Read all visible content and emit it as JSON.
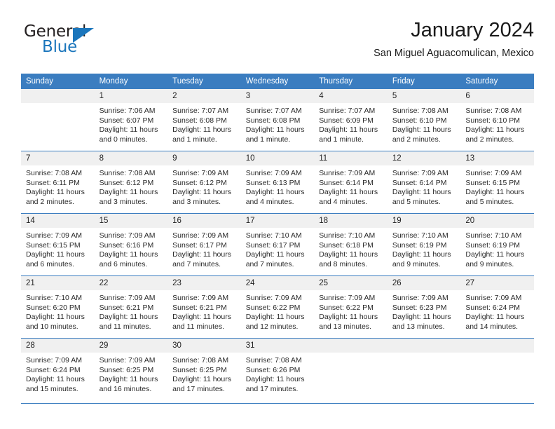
{
  "brand": {
    "word_one": "General",
    "word_two": "Blue",
    "logo_icon": "triangle-logo-icon",
    "accent_color": "#1b76bc"
  },
  "header": {
    "title": "January 2024",
    "subtitle": "San Miguel Aguacomulican, Mexico"
  },
  "theme": {
    "header_blue": "#3b7dc0",
    "daynum_bg": "#f0f0f0",
    "text": "#222222"
  },
  "calendar": {
    "weekday_headers": [
      "Sunday",
      "Monday",
      "Tuesday",
      "Wednesday",
      "Thursday",
      "Friday",
      "Saturday"
    ],
    "weeks": [
      [
        {
          "day": "",
          "blank": true,
          "sunrise": "",
          "sunset": "",
          "daylight_line1": "",
          "daylight_line2": ""
        },
        {
          "day": "1",
          "blank": false,
          "sunrise": "Sunrise: 7:06 AM",
          "sunset": "Sunset: 6:07 PM",
          "daylight_line1": "Daylight: 11 hours",
          "daylight_line2": "and 0 minutes."
        },
        {
          "day": "2",
          "blank": false,
          "sunrise": "Sunrise: 7:07 AM",
          "sunset": "Sunset: 6:08 PM",
          "daylight_line1": "Daylight: 11 hours",
          "daylight_line2": "and 1 minute."
        },
        {
          "day": "3",
          "blank": false,
          "sunrise": "Sunrise: 7:07 AM",
          "sunset": "Sunset: 6:08 PM",
          "daylight_line1": "Daylight: 11 hours",
          "daylight_line2": "and 1 minute."
        },
        {
          "day": "4",
          "blank": false,
          "sunrise": "Sunrise: 7:07 AM",
          "sunset": "Sunset: 6:09 PM",
          "daylight_line1": "Daylight: 11 hours",
          "daylight_line2": "and 1 minute."
        },
        {
          "day": "5",
          "blank": false,
          "sunrise": "Sunrise: 7:08 AM",
          "sunset": "Sunset: 6:10 PM",
          "daylight_line1": "Daylight: 11 hours",
          "daylight_line2": "and 2 minutes."
        },
        {
          "day": "6",
          "blank": false,
          "sunrise": "Sunrise: 7:08 AM",
          "sunset": "Sunset: 6:10 PM",
          "daylight_line1": "Daylight: 11 hours",
          "daylight_line2": "and 2 minutes."
        }
      ],
      [
        {
          "day": "7",
          "blank": false,
          "sunrise": "Sunrise: 7:08 AM",
          "sunset": "Sunset: 6:11 PM",
          "daylight_line1": "Daylight: 11 hours",
          "daylight_line2": "and 2 minutes."
        },
        {
          "day": "8",
          "blank": false,
          "sunrise": "Sunrise: 7:08 AM",
          "sunset": "Sunset: 6:12 PM",
          "daylight_line1": "Daylight: 11 hours",
          "daylight_line2": "and 3 minutes."
        },
        {
          "day": "9",
          "blank": false,
          "sunrise": "Sunrise: 7:09 AM",
          "sunset": "Sunset: 6:12 PM",
          "daylight_line1": "Daylight: 11 hours",
          "daylight_line2": "and 3 minutes."
        },
        {
          "day": "10",
          "blank": false,
          "sunrise": "Sunrise: 7:09 AM",
          "sunset": "Sunset: 6:13 PM",
          "daylight_line1": "Daylight: 11 hours",
          "daylight_line2": "and 4 minutes."
        },
        {
          "day": "11",
          "blank": false,
          "sunrise": "Sunrise: 7:09 AM",
          "sunset": "Sunset: 6:14 PM",
          "daylight_line1": "Daylight: 11 hours",
          "daylight_line2": "and 4 minutes."
        },
        {
          "day": "12",
          "blank": false,
          "sunrise": "Sunrise: 7:09 AM",
          "sunset": "Sunset: 6:14 PM",
          "daylight_line1": "Daylight: 11 hours",
          "daylight_line2": "and 5 minutes."
        },
        {
          "day": "13",
          "blank": false,
          "sunrise": "Sunrise: 7:09 AM",
          "sunset": "Sunset: 6:15 PM",
          "daylight_line1": "Daylight: 11 hours",
          "daylight_line2": "and 5 minutes."
        }
      ],
      [
        {
          "day": "14",
          "blank": false,
          "sunrise": "Sunrise: 7:09 AM",
          "sunset": "Sunset: 6:15 PM",
          "daylight_line1": "Daylight: 11 hours",
          "daylight_line2": "and 6 minutes."
        },
        {
          "day": "15",
          "blank": false,
          "sunrise": "Sunrise: 7:09 AM",
          "sunset": "Sunset: 6:16 PM",
          "daylight_line1": "Daylight: 11 hours",
          "daylight_line2": "and 6 minutes."
        },
        {
          "day": "16",
          "blank": false,
          "sunrise": "Sunrise: 7:09 AM",
          "sunset": "Sunset: 6:17 PM",
          "daylight_line1": "Daylight: 11 hours",
          "daylight_line2": "and 7 minutes."
        },
        {
          "day": "17",
          "blank": false,
          "sunrise": "Sunrise: 7:10 AM",
          "sunset": "Sunset: 6:17 PM",
          "daylight_line1": "Daylight: 11 hours",
          "daylight_line2": "and 7 minutes."
        },
        {
          "day": "18",
          "blank": false,
          "sunrise": "Sunrise: 7:10 AM",
          "sunset": "Sunset: 6:18 PM",
          "daylight_line1": "Daylight: 11 hours",
          "daylight_line2": "and 8 minutes."
        },
        {
          "day": "19",
          "blank": false,
          "sunrise": "Sunrise: 7:10 AM",
          "sunset": "Sunset: 6:19 PM",
          "daylight_line1": "Daylight: 11 hours",
          "daylight_line2": "and 9 minutes."
        },
        {
          "day": "20",
          "blank": false,
          "sunrise": "Sunrise: 7:10 AM",
          "sunset": "Sunset: 6:19 PM",
          "daylight_line1": "Daylight: 11 hours",
          "daylight_line2": "and 9 minutes."
        }
      ],
      [
        {
          "day": "21",
          "blank": false,
          "sunrise": "Sunrise: 7:10 AM",
          "sunset": "Sunset: 6:20 PM",
          "daylight_line1": "Daylight: 11 hours",
          "daylight_line2": "and 10 minutes."
        },
        {
          "day": "22",
          "blank": false,
          "sunrise": "Sunrise: 7:09 AM",
          "sunset": "Sunset: 6:21 PM",
          "daylight_line1": "Daylight: 11 hours",
          "daylight_line2": "and 11 minutes."
        },
        {
          "day": "23",
          "blank": false,
          "sunrise": "Sunrise: 7:09 AM",
          "sunset": "Sunset: 6:21 PM",
          "daylight_line1": "Daylight: 11 hours",
          "daylight_line2": "and 11 minutes."
        },
        {
          "day": "24",
          "blank": false,
          "sunrise": "Sunrise: 7:09 AM",
          "sunset": "Sunset: 6:22 PM",
          "daylight_line1": "Daylight: 11 hours",
          "daylight_line2": "and 12 minutes."
        },
        {
          "day": "25",
          "blank": false,
          "sunrise": "Sunrise: 7:09 AM",
          "sunset": "Sunset: 6:22 PM",
          "daylight_line1": "Daylight: 11 hours",
          "daylight_line2": "and 13 minutes."
        },
        {
          "day": "26",
          "blank": false,
          "sunrise": "Sunrise: 7:09 AM",
          "sunset": "Sunset: 6:23 PM",
          "daylight_line1": "Daylight: 11 hours",
          "daylight_line2": "and 13 minutes."
        },
        {
          "day": "27",
          "blank": false,
          "sunrise": "Sunrise: 7:09 AM",
          "sunset": "Sunset: 6:24 PM",
          "daylight_line1": "Daylight: 11 hours",
          "daylight_line2": "and 14 minutes."
        }
      ],
      [
        {
          "day": "28",
          "blank": false,
          "sunrise": "Sunrise: 7:09 AM",
          "sunset": "Sunset: 6:24 PM",
          "daylight_line1": "Daylight: 11 hours",
          "daylight_line2": "and 15 minutes."
        },
        {
          "day": "29",
          "blank": false,
          "sunrise": "Sunrise: 7:09 AM",
          "sunset": "Sunset: 6:25 PM",
          "daylight_line1": "Daylight: 11 hours",
          "daylight_line2": "and 16 minutes."
        },
        {
          "day": "30",
          "blank": false,
          "sunrise": "Sunrise: 7:08 AM",
          "sunset": "Sunset: 6:25 PM",
          "daylight_line1": "Daylight: 11 hours",
          "daylight_line2": "and 17 minutes."
        },
        {
          "day": "31",
          "blank": false,
          "sunrise": "Sunrise: 7:08 AM",
          "sunset": "Sunset: 6:26 PM",
          "daylight_line1": "Daylight: 11 hours",
          "daylight_line2": "and 17 minutes."
        },
        {
          "day": "",
          "blank": true,
          "sunrise": "",
          "sunset": "",
          "daylight_line1": "",
          "daylight_line2": ""
        },
        {
          "day": "",
          "blank": true,
          "sunrise": "",
          "sunset": "",
          "daylight_line1": "",
          "daylight_line2": ""
        },
        {
          "day": "",
          "blank": true,
          "sunrise": "",
          "sunset": "",
          "daylight_line1": "",
          "daylight_line2": ""
        }
      ]
    ]
  }
}
